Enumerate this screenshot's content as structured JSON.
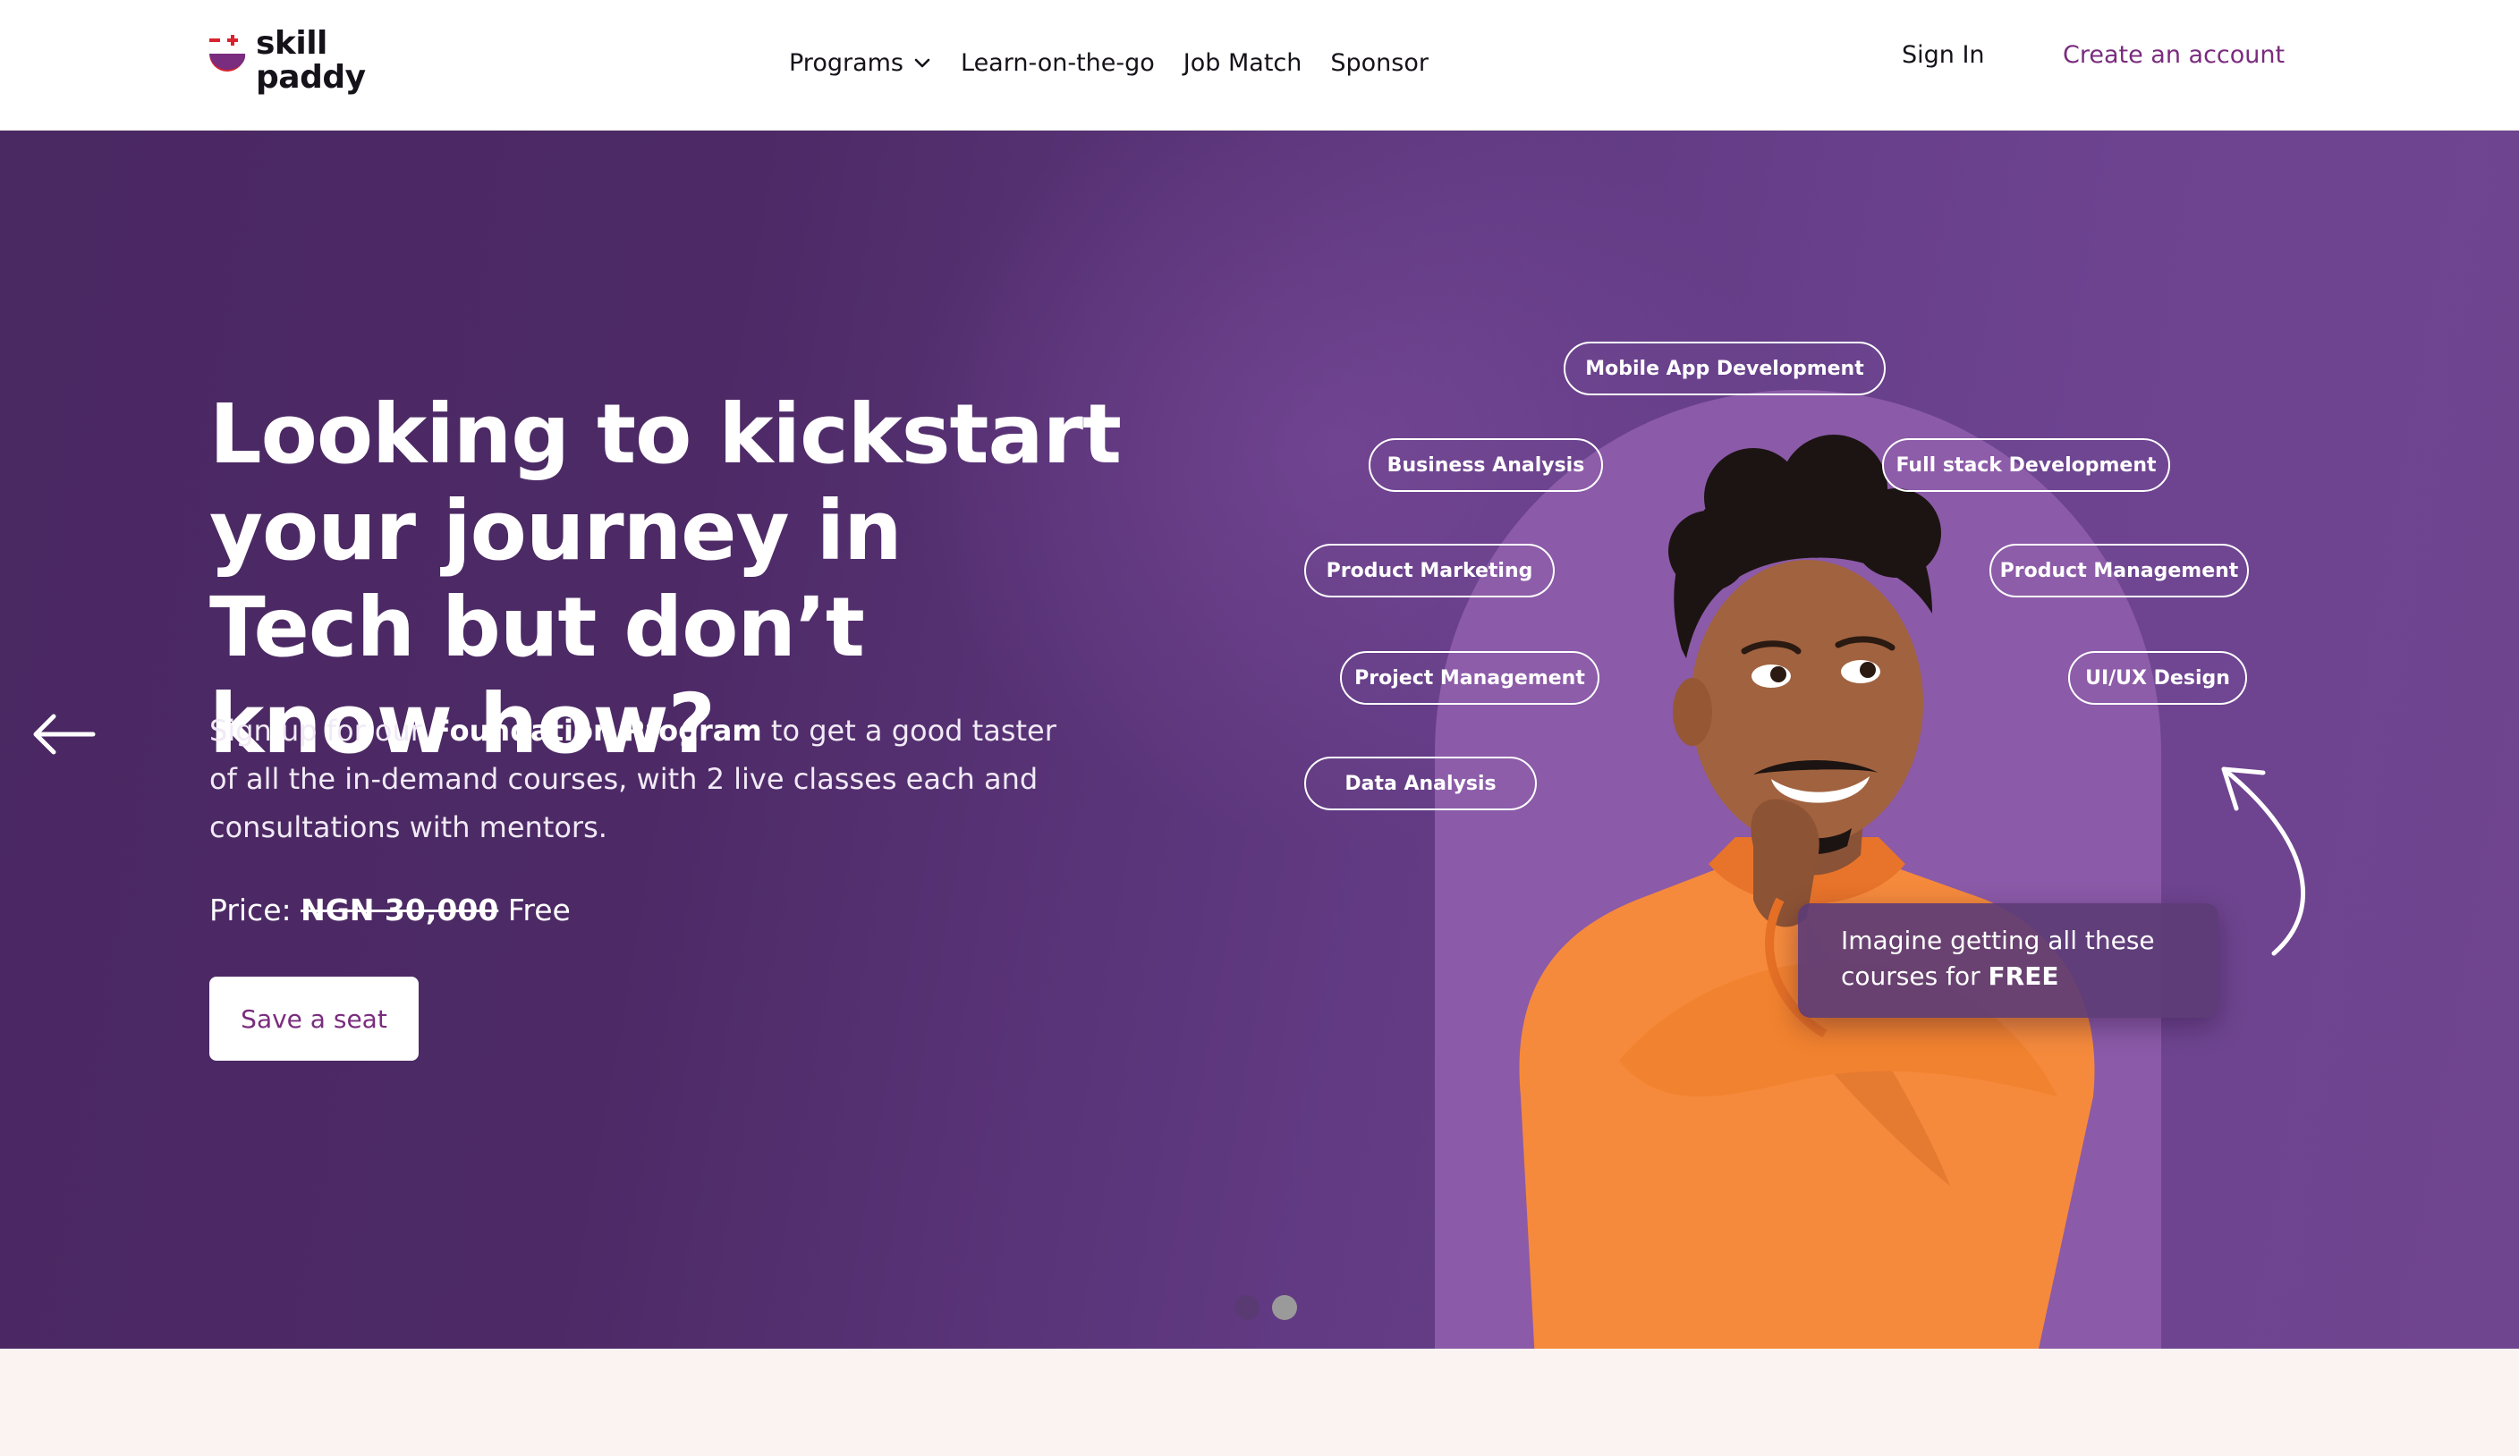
{
  "brand": {
    "name_line1": "skill",
    "name_line2": "paddy",
    "colors": {
      "red": "#d9232e",
      "purple": "#7a2c7e",
      "hero_dark": "#4a2862",
      "hero_light": "#70458f",
      "hoodie": "#f58a3c"
    }
  },
  "nav": {
    "items": [
      {
        "label": "Programs",
        "has_dropdown": true
      },
      {
        "label": "Learn-on-the-go"
      },
      {
        "label": "Job Match"
      },
      {
        "label": "Sponsor"
      }
    ],
    "sign_in": "Sign In",
    "create_account": "Create an account"
  },
  "hero": {
    "headline": "Looking to kickstart your journey in Tech but don’t know how?",
    "sub_pre": "Sign up for our ",
    "sub_bold": "Foundation Program",
    "sub_post": " to get a good taster of all the in-demand courses, with 2 live classes each and consultations with mentors.",
    "price_label": "Price: ",
    "price_old": "NGN 30,000",
    "price_new": " Free",
    "cta": "Save a seat",
    "courses": [
      "Mobile App Development",
      "Business Analysis",
      "Full stack Development",
      "Product Marketing",
      "Product Management",
      "Project Management",
      "UI/UX Design",
      "Data Analysis"
    ],
    "tooltip_pre": "Imagine getting all these courses for ",
    "tooltip_bold": "FREE"
  },
  "carousel": {
    "slide_count": 2,
    "active_index": 1
  },
  "icons": {
    "prev": "arrow-left-icon",
    "dropdown": "chevron-down-icon",
    "pointer": "curved-arrow-icon"
  }
}
